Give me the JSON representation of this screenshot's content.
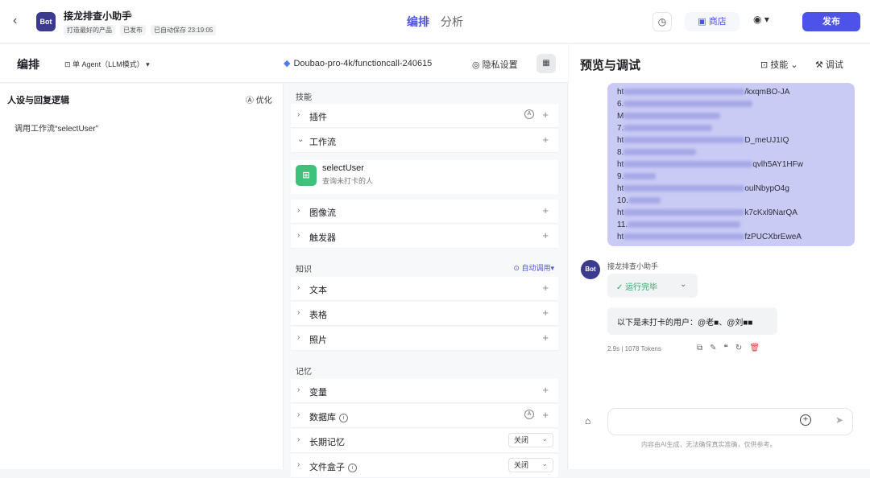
{
  "topbar": {
    "bot_avatar": "Bot",
    "bot_name": "接龙排查小助手",
    "meta": [
      "打造最好的产品",
      "已发布",
      "已自动保存 23:19:05"
    ],
    "mode_tabs": [
      "编排",
      "分析"
    ],
    "store": "商店",
    "publish": "发布"
  },
  "editor": {
    "title": "编排",
    "agent_mode": "单 Agent（LLM模式）",
    "model": "Doubao-pro-4k/functioncall-240615",
    "privacy": "隐私设置"
  },
  "persona": {
    "title": "人设与回复逻辑",
    "optimize": "优化",
    "body": "调用工作流“selectUser”"
  },
  "skills": {
    "section": "技能",
    "plugin": "插件",
    "workflow": "工作流",
    "workflow_item": {
      "name": "selectUser",
      "desc": "查询未打卡的人"
    },
    "imageflow": "图像流",
    "trigger": "触发器"
  },
  "knowledge": {
    "section": "知识",
    "auto_call": "自动调用",
    "text": "文本",
    "table": "表格",
    "photo": "照片"
  },
  "memory": {
    "section": "记忆",
    "variable": "变量",
    "database": "数据库",
    "longterm": "长期记忆",
    "longterm_value": "关闭",
    "filebox": "文件盒子",
    "filebox_value": "关闭"
  },
  "preview": {
    "title": "预览与调试",
    "skill": "技能",
    "debug": "调试",
    "user_msg_lines": [
      "ht",
      "6.",
      "M",
      "7.",
      "ht",
      "8.",
      "ht",
      "9.",
      "ht",
      "10.",
      "ht",
      "11.",
      "ht"
    ],
    "user_msg_tails": [
      "/kxqmBO-JA",
      "",
      "",
      "",
      "D_meUJ1IQ",
      "",
      "qvlh5AY1HFw",
      "",
      "oulNbypO4g",
      "",
      "k7cKxl9NarQA",
      "",
      "fzPUCXbrEweA"
    ],
    "bot_avatar": "Bot",
    "bot_name": "接龙排查小助手",
    "run_status": "运行完毕",
    "reply": "以下是未打卡的用户：@老■、@刘■■",
    "stats": "2.9s  |  1078 Tokens",
    "disclaimer": "内容由AI生成，无法确保真实准确，仅供参考。"
  }
}
